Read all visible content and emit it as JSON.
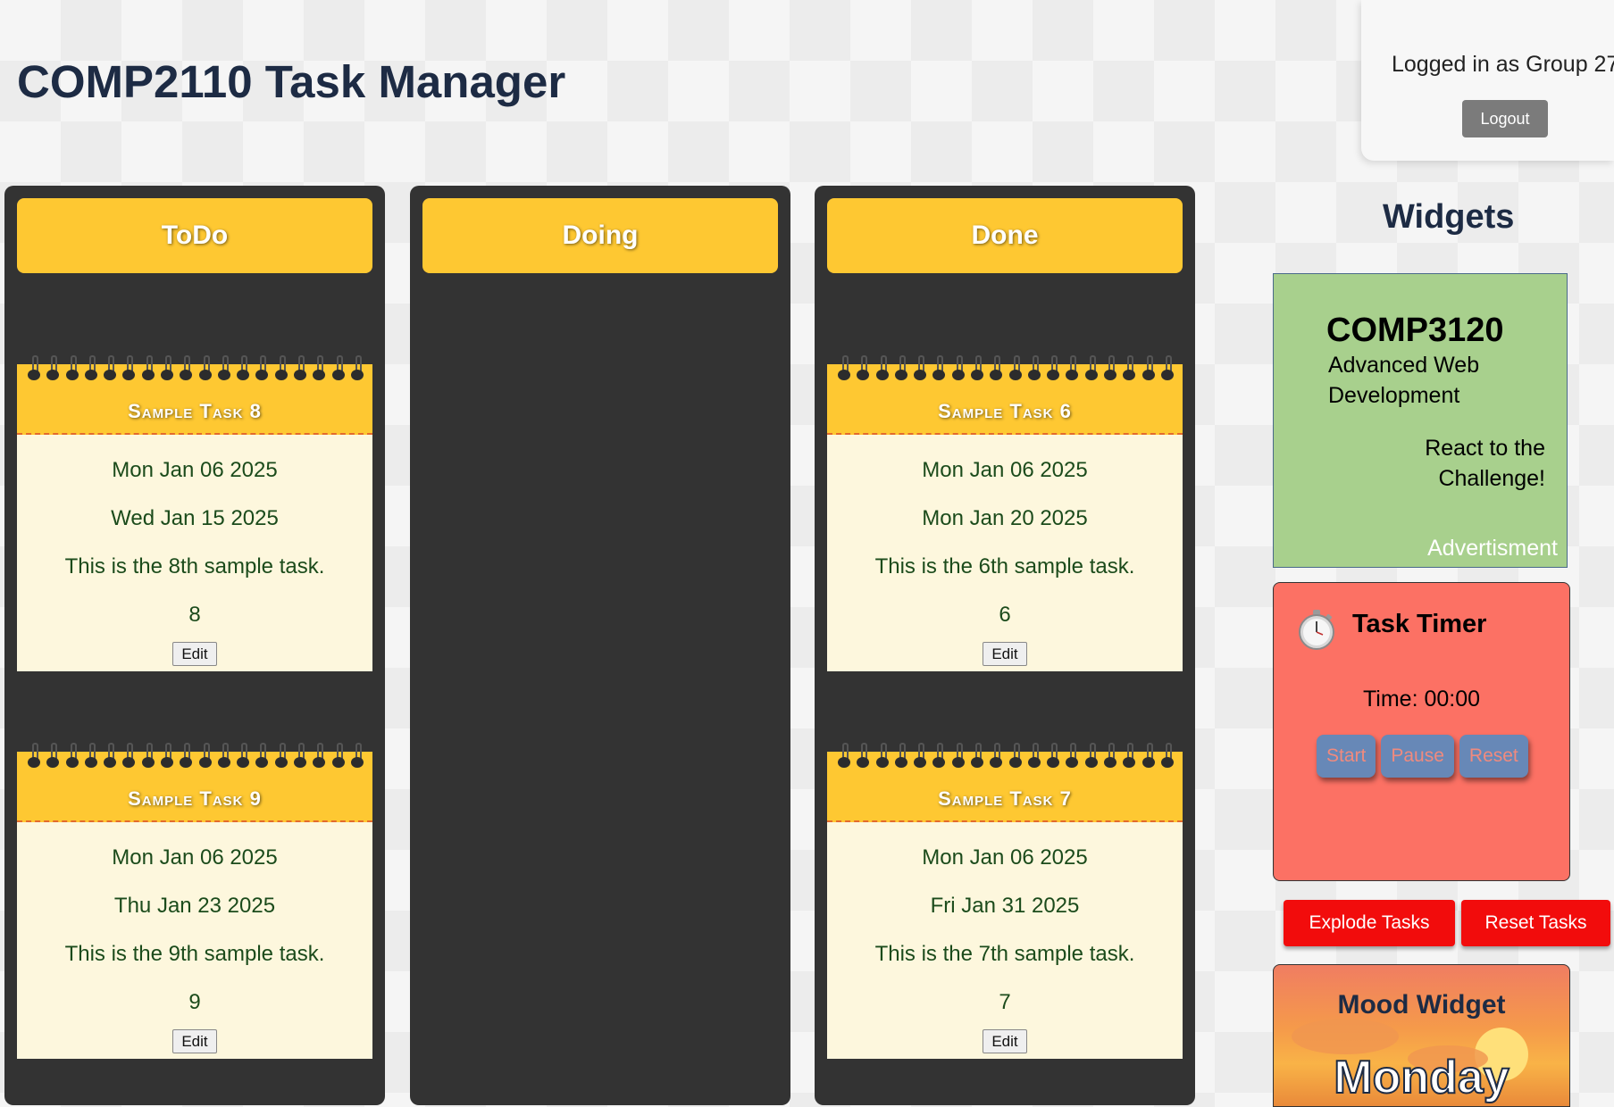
{
  "header": {
    "title": "COMP2110 Task Manager",
    "login_text": "Logged in as Group 27",
    "logout_label": "Logout"
  },
  "columns": [
    {
      "name": "ToDo",
      "cards": [
        {
          "title": "Sample Task 8",
          "start": "Mon Jan 06 2025",
          "due": "Wed Jan 15 2025",
          "summary": "This is the 8th sample task.",
          "priority": "8",
          "edit_label": "Edit"
        },
        {
          "title": "Sample Task 9",
          "start": "Mon Jan 06 2025",
          "due": "Thu Jan 23 2025",
          "summary": "This is the 9th sample task.",
          "priority": "9",
          "edit_label": "Edit"
        }
      ]
    },
    {
      "name": "Doing",
      "cards": []
    },
    {
      "name": "Done",
      "cards": [
        {
          "title": "Sample Task 6",
          "start": "Mon Jan 06 2025",
          "due": "Mon Jan 20 2025",
          "summary": "This is the 6th sample task.",
          "priority": "6",
          "edit_label": "Edit"
        },
        {
          "title": "Sample Task 7",
          "start": "Mon Jan 06 2025",
          "due": "Fri Jan 31 2025",
          "summary": "This is the 7th sample task.",
          "priority": "7",
          "edit_label": "Edit"
        }
      ]
    }
  ],
  "widgets": {
    "heading": "Widgets",
    "ad": {
      "course": "COMP3120",
      "subtitle_line1": "Advanced Web",
      "subtitle_line2": "Development",
      "tagline_line1": "React to the",
      "tagline_line2": "Challenge!",
      "label": "Advertisment",
      "color": "#a8d08d"
    },
    "timer": {
      "icon": "stopwatch-icon",
      "title": "Task Timer",
      "time": "Time: 00:00",
      "start_label": "Start",
      "pause_label": "Pause",
      "reset_label": "Reset",
      "color": "#fc7164"
    },
    "explode_label": "Explode Tasks",
    "reset_tasks_label": "Reset Tasks",
    "mood": {
      "title": "Mood Widget",
      "day": "Monday"
    }
  },
  "colors": {
    "accent_yellow": "#fec832",
    "column_bg": "#333333",
    "card_bg": "#fdf7dd",
    "danger_red": "#f20c0c"
  }
}
